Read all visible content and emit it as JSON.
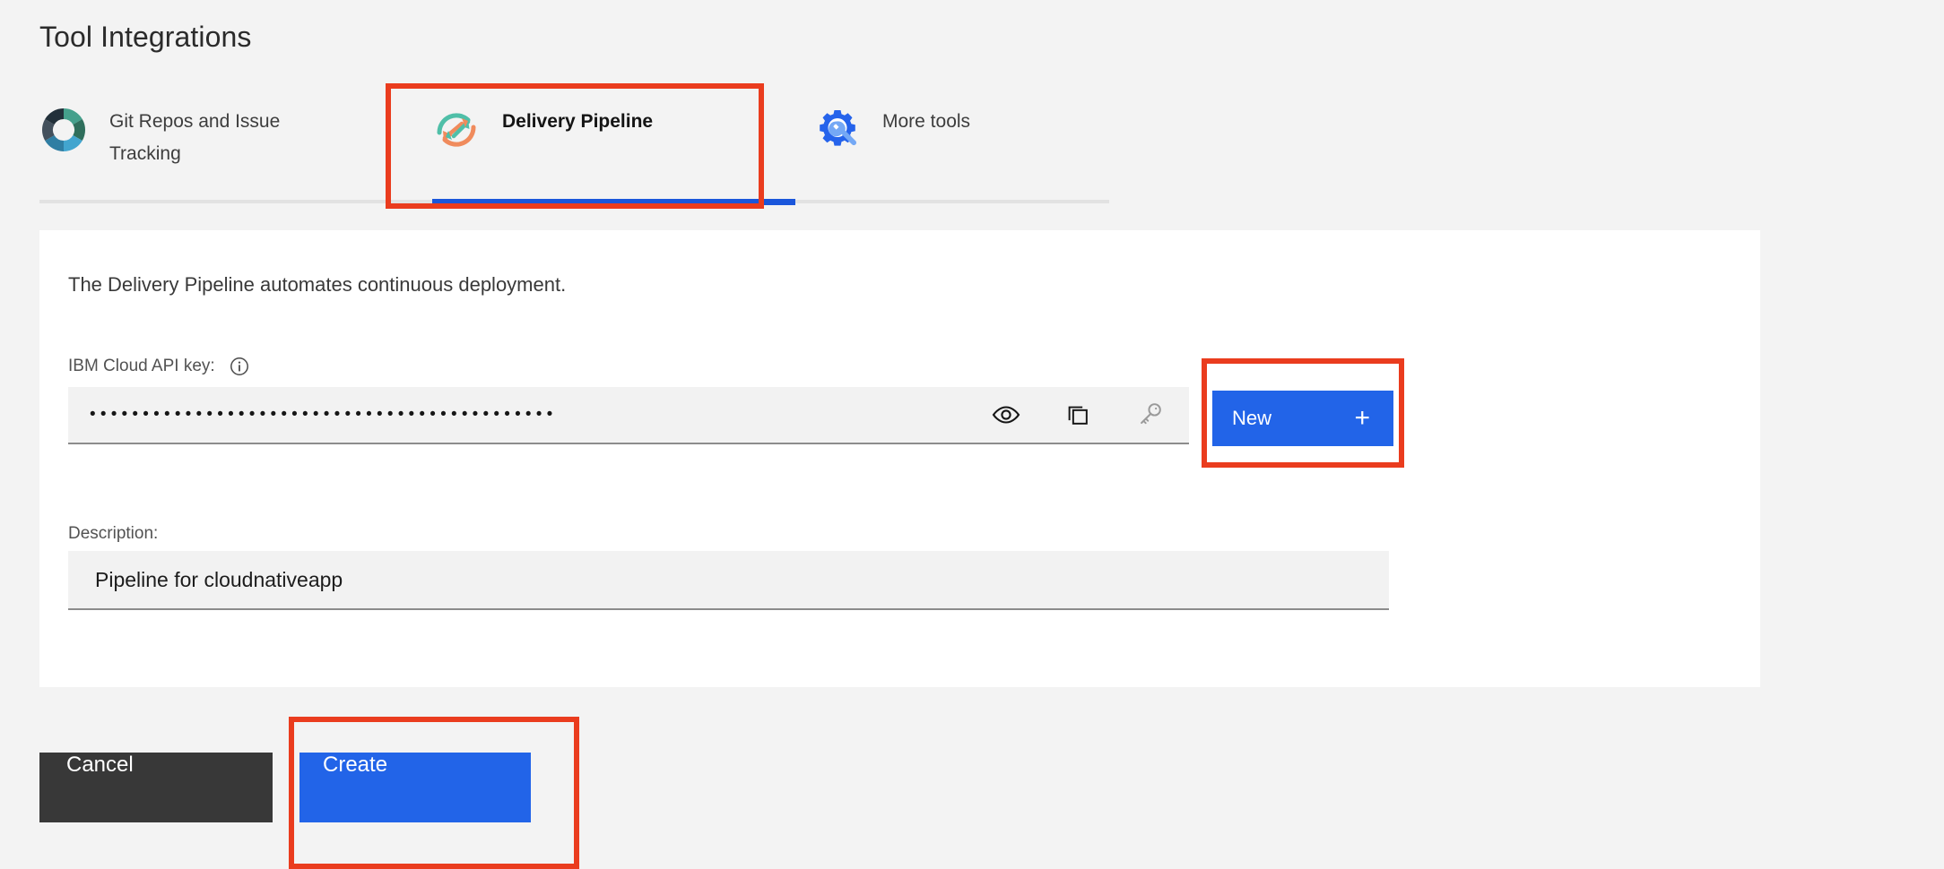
{
  "header": {
    "title": "Tool Integrations"
  },
  "tabs": [
    {
      "id": "git",
      "label": "Git Repos and Issue Tracking",
      "icon": "git-repos-donut-icon",
      "active": false
    },
    {
      "id": "pipe",
      "label": "Delivery Pipeline",
      "icon": "delivery-pipeline-icon",
      "active": true
    },
    {
      "id": "more",
      "label": "More tools",
      "icon": "gear-wrench-icon",
      "active": false
    }
  ],
  "card": {
    "description_text": "The Delivery Pipeline automates continuous deployment.",
    "api_key": {
      "label": "IBM Cloud API key:",
      "info_icon": "info-icon",
      "value": "••••••••••••••••••••••••••••••••••••••••••••",
      "placeholder": "",
      "masked": true,
      "actions": [
        {
          "name": "show-password-icon",
          "icon": "eye-icon",
          "enabled": true
        },
        {
          "name": "copy-icon",
          "icon": "copy-icon",
          "enabled": true
        },
        {
          "name": "key-icon",
          "icon": "key-icon",
          "enabled": false
        }
      ]
    },
    "new_button": {
      "label": "New",
      "plus": "+"
    },
    "description_field": {
      "label": "Description:",
      "value": "Pipeline for cloudnativeapp",
      "placeholder": "Description"
    }
  },
  "footer": {
    "cancel_label": "Cancel",
    "create_label": "Create"
  },
  "annotations": [
    {
      "name": "annotation-box-delivery-pipeline-tab"
    },
    {
      "name": "annotation-box-new-button"
    },
    {
      "name": "annotation-box-create-button"
    }
  ],
  "colors": {
    "accent_blue": "#2264e8",
    "tab_underline_blue": "#1a56db",
    "annotation_red": "#ea3c1e",
    "cancel_dark": "#383838",
    "page_background": "#f3f3f3",
    "card_background": "#ffffff",
    "input_background": "#f2f2f2"
  }
}
